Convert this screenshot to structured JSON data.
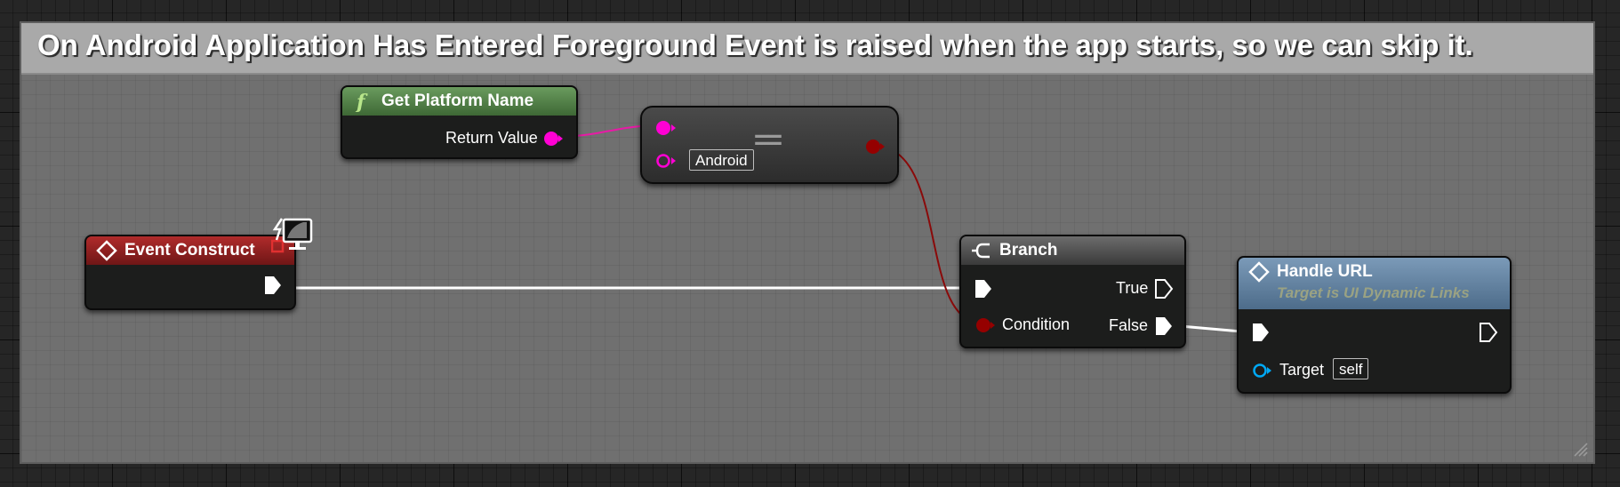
{
  "comment": {
    "title": "On Android Application Has Entered Foreground Event is raised when the app starts, so we can skip it."
  },
  "nodes": {
    "get_platform_name": {
      "title": "Get Platform Name",
      "return_value_label": "Return Value",
      "header_color": "#4a7a3f",
      "icon": "function-icon"
    },
    "equal": {
      "operator": "==",
      "b_default": "Android",
      "icon": "equals-icon"
    },
    "event_construct": {
      "title": "Event Construct",
      "header_color": "#8e1f1f",
      "icon": "event-icon",
      "badge_icon": "client-only-monitor-icon"
    },
    "branch": {
      "title": "Branch",
      "true_label": "True",
      "false_label": "False",
      "condition_label": "Condition",
      "header_color": "#555555",
      "icon": "branch-icon"
    },
    "handle_url": {
      "title": "Handle URL",
      "subtitle": "Target is UI Dynamic Links",
      "target_label": "Target",
      "target_default": "self",
      "header_color": "#5d7d9a",
      "icon": "function-icon"
    }
  },
  "colors": {
    "string_pin": "#ff00d4",
    "bool_pin": "#950000",
    "exec_pin": "#ffffff",
    "object_pin": "#00a8f3"
  }
}
